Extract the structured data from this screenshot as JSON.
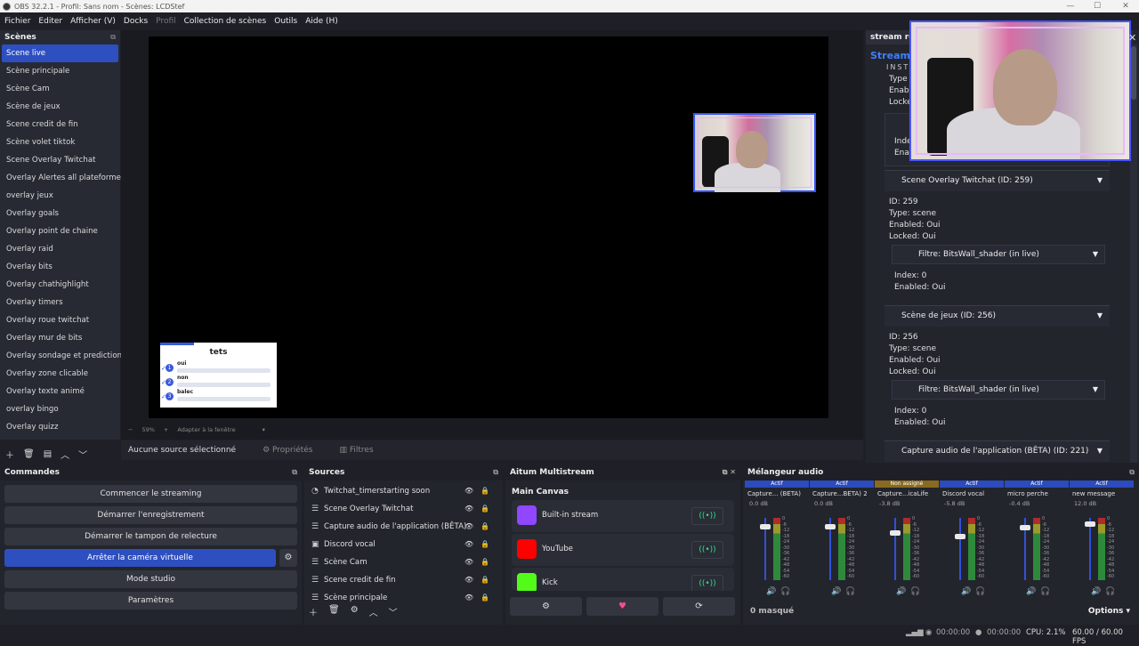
{
  "window": {
    "title": "OBS 32.2.1 - Profil: Sans nom - Scènes: LCDStef"
  },
  "menu": [
    "Fichier",
    "Editer",
    "Afficher (V)",
    "Docks",
    "Profil",
    "Collection de scènes",
    "Outils",
    "Aide (H)"
  ],
  "scenes": {
    "title": "Scènes",
    "items": [
      "Scene live",
      "Scène principale",
      "Scène Cam",
      "Scène de jeux",
      "Scene credit de fin",
      "Scène volet tiktok",
      "Scene Overlay Twitchat",
      "Overlay Alertes all plateforme",
      "overlay jeux",
      "Overlay goals",
      "Overlay point de chaine",
      "Overlay raid",
      "Overlay bits",
      "Overlay chathighlight",
      "Overlay timers",
      "Overlay roue twitchat",
      "Overlay mur de bits",
      "Overlay sondage et prediction",
      "Overlay zone clicable",
      "Overlay texte animé",
      "overlay bingo",
      "Overlay quizz"
    ],
    "selected": 0
  },
  "preview": {
    "poll": {
      "title": "tets",
      "options": [
        {
          "num": "1",
          "label": "oui"
        },
        {
          "num": "2",
          "label": "non"
        },
        {
          "num": "3",
          "label": "balec"
        }
      ]
    },
    "zoom": "59%",
    "fit": "Adapter à la fenêtre"
  },
  "source_bar": {
    "none_selected": "Aucune source sélectionné",
    "properties": "Propriétés",
    "filters": "Filtres"
  },
  "right_panel": {
    "title": "stream ro",
    "brand": "Stream",
    "brand_sub": "INST",
    "top_lines": [
      "Type",
      "Enabl",
      "Locke",
      "Inde",
      "Enab"
    ],
    "sections": [
      {
        "header": "Scene Overlay Twitchat (ID: 259)",
        "id": "ID: 259",
        "type": "Type: scene",
        "enabled": "Enabled: Oui",
        "locked": "Locked: Oui",
        "filter": "Filtre: BitsWall_shader (in live)",
        "index": "Index: 0",
        "fenabled": "Enabled: Oui"
      },
      {
        "header": "Scène de jeux (ID: 256)",
        "id": "ID: 256",
        "type": "Type: scene",
        "enabled": "Enabled: Oui",
        "locked": "Locked: Oui",
        "filter": "Filtre: BitsWall_shader (in live)",
        "index": "Index: 0",
        "fenabled": "Enabled: Oui"
      },
      {
        "header": "Capture audio de l'application (BÊTA) (ID: 221)"
      }
    ]
  },
  "controls": {
    "title": "Commandes",
    "buttons": [
      "Commencer le streaming",
      "Démarrer l'enregistrement",
      "Démarrer le tampon de relecture",
      "Arrêter la caméra virtuelle",
      "Mode studio",
      "Paramètres"
    ]
  },
  "sources": {
    "title": "Sources",
    "items": [
      "Twitchat_timerstarting soon",
      "Scene Overlay Twitchat",
      "Capture audio de l'application (BÊTA)",
      "Discord vocal",
      "Scène Cam",
      "Scene credit de fin",
      "Scène principale"
    ]
  },
  "multistream": {
    "title": "Aitum Multistream",
    "canvas": "Main Canvas",
    "platforms": [
      {
        "name": "Built-in stream",
        "color": "#9146ff"
      },
      {
        "name": "YouTube",
        "color": "#ff0000"
      },
      {
        "name": "Kick",
        "color": "#53fc18"
      }
    ]
  },
  "mixer": {
    "title": "Mélangeur audio",
    "channels": [
      {
        "status": "Actif",
        "name": "Capture... (BÊTA)",
        "db": "0.0 dB",
        "level": 0.9
      },
      {
        "status": "Actif",
        "name": "Capture...BÊTA) 2",
        "db": "0.0 dB",
        "level": 0.9
      },
      {
        "status": "Non assigné",
        "name": "Capture...icaLife",
        "db": "-3.8 dB",
        "level": 0.8
      },
      {
        "status": "Actif",
        "name": "Discord vocal",
        "db": "-5.8 dB",
        "level": 0.75
      },
      {
        "status": "Actif",
        "name": "micro perche",
        "db": "-0.4 dB",
        "level": 0.88
      },
      {
        "status": "Actif",
        "name": "new message",
        "db": "12.0 dB",
        "level": 0.95
      }
    ],
    "scale": [
      "0",
      "-6",
      "-12",
      "-18",
      "-24",
      "-30",
      "-36",
      "-42",
      "-48",
      "-54",
      "-60"
    ],
    "hidden": "0 masqué",
    "options": "Options"
  },
  "status": {
    "rec_time": "00:00:00",
    "stream_time": "00:00:00",
    "cpu": "CPU: 2.1%",
    "fps": "60.00 / 60.00 FPS"
  }
}
